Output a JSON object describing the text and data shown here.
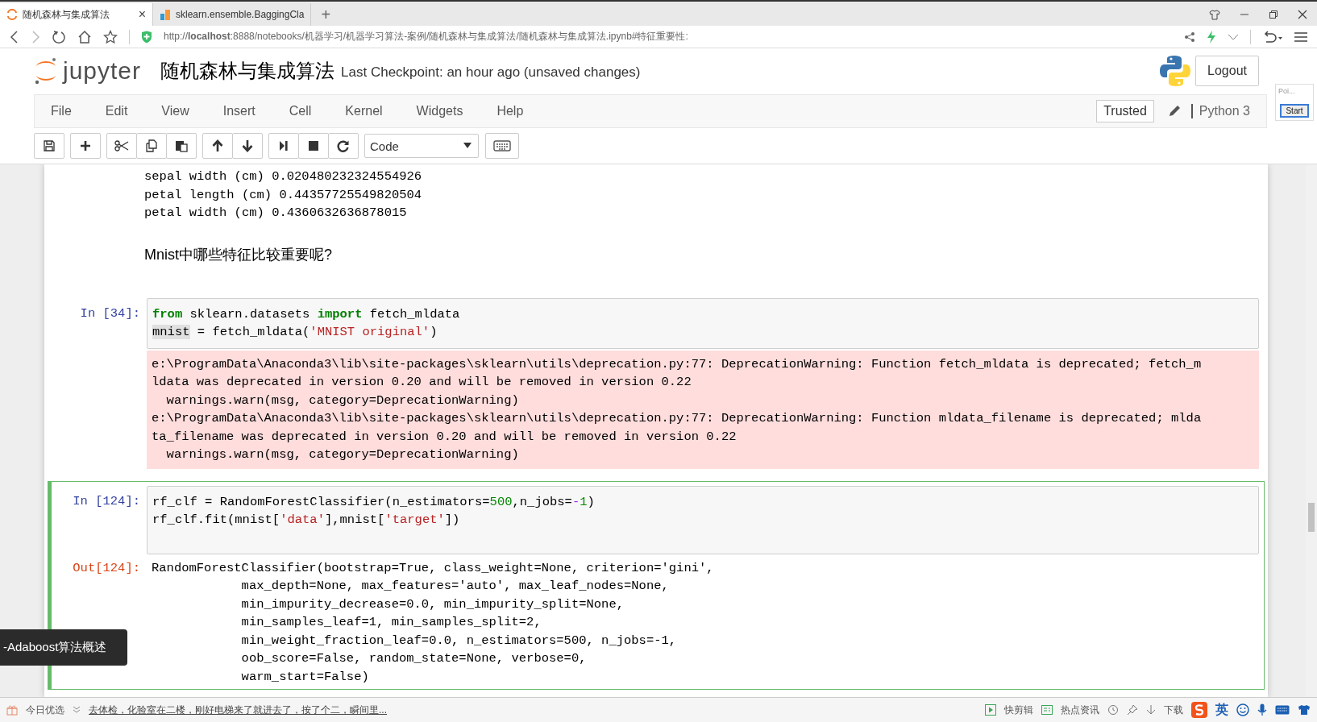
{
  "browser": {
    "tabs": [
      {
        "title": "随机森林与集成算法",
        "selected": true,
        "close": "×"
      },
      {
        "title": "sklearn.ensemble.BaggingCla",
        "selected": false
      }
    ],
    "new_tab": "+",
    "url": "http://**localhost**:8888/notebooks/机器学习/机器学习算法-案例/随机森林与集成算法/随机森林与集成算法.ipynb#特征重要性:"
  },
  "header": {
    "logo": "jupyter",
    "title": "随机森林与集成算法",
    "checkpoint": "Last Checkpoint: an hour ago (unsaved changes)",
    "logout": "Logout"
  },
  "menu": [
    "File",
    "Edit",
    "View",
    "Insert",
    "Cell",
    "Kernel",
    "Widgets",
    "Help"
  ],
  "kernel": {
    "trusted": "Trusted",
    "name": "Python 3"
  },
  "toolbar": {
    "cell_type": "Code"
  },
  "cells": [
    {
      "kind": "output_tail",
      "lines": [
        "sepal width (cm) 0.020480232324554926",
        "petal length (cm) 0.44357725549820504",
        "petal width (cm) 0.4360632636878015"
      ]
    },
    {
      "kind": "markdown",
      "text": "Mnist中哪些特征比较重要呢?"
    },
    {
      "kind": "code",
      "prompt": "In [34]:",
      "selected": false,
      "input": [
        [
          {
            "t": "from",
            "kind": "keyword"
          },
          {
            "t": " sklearn.datasets ",
            "kind": "plain"
          },
          {
            "t": "import",
            "kind": "keyword"
          },
          {
            "t": " fetch_mldata",
            "kind": "plain"
          }
        ],
        [
          {
            "t": "mnist",
            "kind": "highlight"
          },
          {
            "t": " = fetch_mldata(",
            "kind": "plain"
          },
          {
            "t": "'MNIST original'",
            "kind": "string"
          },
          {
            "t": ")",
            "kind": "plain"
          }
        ]
      ],
      "output": {
        "kind": "stderr",
        "lines": [
          "e:\\ProgramData\\Anaconda3\\lib\\site-packages\\sklearn\\utils\\deprecation.py:77: DeprecationWarning: Function fetch_mldata is deprecated; fetch_m",
          "ldata was deprecated in version 0.20 and will be removed in version 0.22",
          "  warnings.warn(msg, category=DeprecationWarning)",
          "e:\\ProgramData\\Anaconda3\\lib\\site-packages\\sklearn\\utils\\deprecation.py:77: DeprecationWarning: Function mldata_filename is deprecated; mlda",
          "ta_filename was deprecated in version 0.20 and will be removed in version 0.22",
          "  warnings.warn(msg, category=DeprecationWarning)"
        ]
      }
    },
    {
      "kind": "code",
      "prompt": "In [124]:",
      "selected": true,
      "input": [
        [
          {
            "t": "rf_clf = RandomForestClassifier(n_estimators=",
            "kind": "plain"
          },
          {
            "t": "500",
            "kind": "number"
          },
          {
            "t": ",n_jobs=",
            "kind": "plain"
          },
          {
            "t": "-",
            "kind": "operator"
          },
          {
            "t": "1",
            "kind": "number"
          },
          {
            "t": ")",
            "kind": "plain"
          }
        ],
        [
          {
            "t": "rf_clf.fit(mnist[",
            "kind": "plain"
          },
          {
            "t": "'data'",
            "kind": "string"
          },
          {
            "t": "],mnist[",
            "kind": "plain"
          },
          {
            "t": "'target'",
            "kind": "string"
          },
          {
            "t": "])",
            "kind": "plain"
          }
        ]
      ],
      "output": {
        "kind": "result",
        "prompt": "Out[124]:",
        "lines": [
          "RandomForestClassifier(bootstrap=True, class_weight=None, criterion='gini',",
          "            max_depth=None, max_features='auto', max_leaf_nodes=None,",
          "            min_impurity_decrease=0.0, min_impurity_split=None,",
          "            min_samples_leaf=1, min_samples_split=2,",
          "            min_weight_fraction_leaf=0.0, n_estimators=500, n_jobs=-1,",
          "            oob_score=False, random_state=None, verbose=0,",
          "            warm_start=False)"
        ]
      }
    }
  ],
  "popup": {
    "title": "Poi...",
    "button": "Start"
  },
  "tooltip": "-Adaboost算法概述",
  "status_bar": {
    "featured": "今日优选",
    "news": "去体检，化验室在二楼，刚好电梯来了就进去了，按了个二，瞬间里...",
    "items": [
      "快剪辑",
      "热点资讯",
      "下载"
    ],
    "ime": "英"
  }
}
